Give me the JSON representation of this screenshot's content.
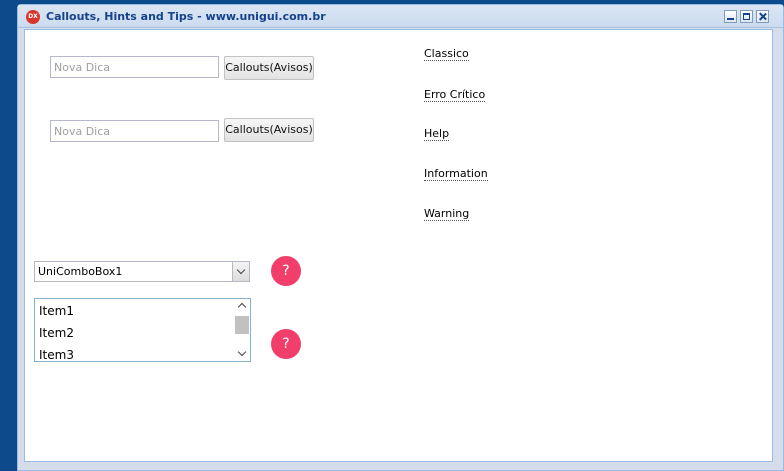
{
  "window": {
    "title": "Callouts, Hints and Tips - www.unigui.com.br",
    "icon_label": "DX"
  },
  "fields": [
    {
      "placeholder": "Nova Dica",
      "button_label": "Callouts(Avisos)"
    },
    {
      "placeholder": "Nova Dica",
      "button_label": "Callouts(Avisos)"
    }
  ],
  "links": [
    "Classico",
    "Erro Crítico",
    "Help",
    "Information",
    "Warning"
  ],
  "combo": {
    "value": "UniComboBox1"
  },
  "help_badge": "?",
  "list": {
    "items": [
      "Item1",
      "Item2",
      "Item3"
    ]
  },
  "colors": {
    "desktop": "#0d4a8c",
    "title_text": "#15428b",
    "help_badge": "#f23e6a"
  }
}
